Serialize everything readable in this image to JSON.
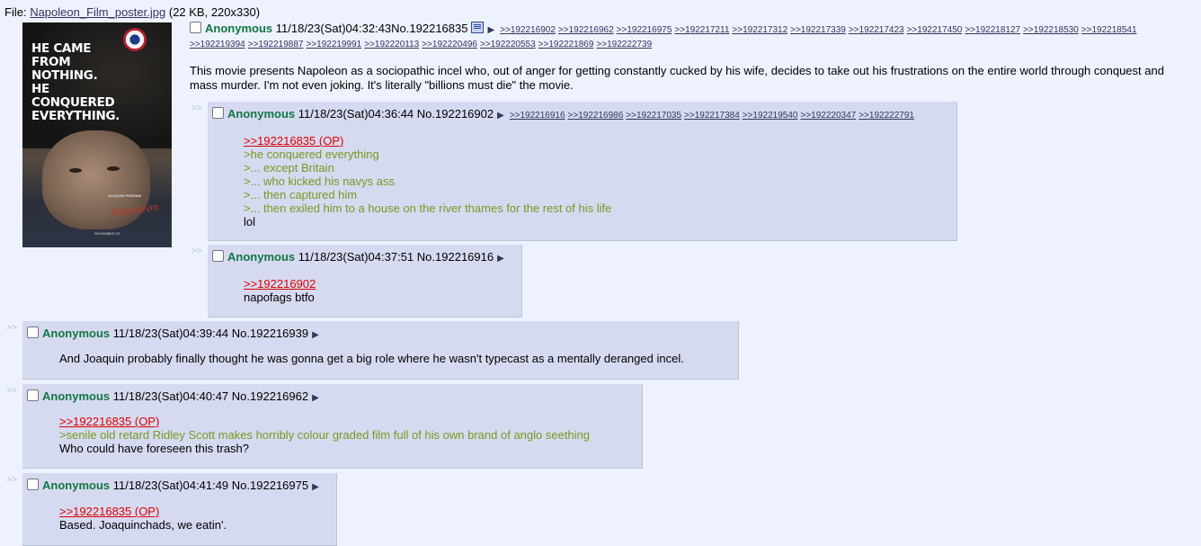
{
  "file": {
    "label": "File:",
    "name": "Napoleon_Film_poster.jpg",
    "info": "(22 KB, 220x330)",
    "poster_tagline": [
      "HE CAME FROM",
      "NOTHING.",
      "HE CONQUERED",
      "EVERYTHING."
    ],
    "poster_credits": "JOAQUIN PHOENIX",
    "poster_title": "Napoleon",
    "poster_release": "NOVEMBER 22"
  },
  "arrow": "▶",
  "side_arrows": ">>",
  "op": {
    "name": "Anonymous",
    "datetime": "11/18/23(Sat)04:32:43",
    "no_label": "No.",
    "no": "192216835",
    "backlinks_line1": [
      ">>192216902",
      ">>192216962",
      ">>192216975",
      ">>192217211",
      ">>192217312",
      ">>192217339",
      ">>192217423",
      ">>192217450",
      ">>192218127",
      ">>192218530",
      ">>192218541"
    ],
    "backlinks_line2": [
      ">>192219394",
      ">>192219887",
      ">>192219991",
      ">>192220113",
      ">>192220496",
      ">>192220553",
      ">>192221869",
      ">>192222739"
    ],
    "message": "This movie presents Napoleon as a sociopathic incel who, out of anger for getting constantly cucked by his wife, decides to take out his frustrations on the entire world through conquest and mass murder. I'm not even joking. It's literally \"billions must die\" the movie."
  },
  "replies": [
    {
      "name": "Anonymous",
      "datetime": "11/18/23(Sat)04:36:44",
      "no_label": "No.",
      "no": "192216902",
      "backlinks": [
        ">>192216916",
        ">>192216986",
        ">>192217035",
        ">>192217384",
        ">>192219540",
        ">>192220347",
        ">>192222791"
      ],
      "quotelink": ">>192216835 (OP)",
      "greentext": [
        ">he conquered everything",
        ">... except Britain",
        ">... who kicked his navys ass",
        ">... then captured him",
        ">... then exiled him to a house on the river thames for the rest of his life"
      ],
      "text": [
        "lol"
      ]
    },
    {
      "name": "Anonymous",
      "datetime": "11/18/23(Sat)04:37:51",
      "no_label": "No.",
      "no": "192216916",
      "quotelink": ">>192216902",
      "text": [
        "napofags btfo"
      ]
    },
    {
      "name": "Anonymous",
      "datetime": "11/18/23(Sat)04:39:44",
      "no_label": "No.",
      "no": "192216939",
      "text": [
        "And Joaquin probably finally thought he was gonna get a big role where he wasn't typecast as a mentally deranged incel."
      ]
    },
    {
      "name": "Anonymous",
      "datetime": "11/18/23(Sat)04:40:47",
      "no_label": "No.",
      "no": "192216962",
      "quotelink": ">>192216835 (OP)",
      "greentext": [
        ">senile old retard Ridley Scott makes horribly colour graded film full of his own brand of anglo seething"
      ],
      "text": [
        "Who could have foreseen this trash?"
      ]
    },
    {
      "name": "Anonymous",
      "datetime": "11/18/23(Sat)04:41:49",
      "no_label": "No.",
      "no": "192216975",
      "quotelink": ">>192216835 (OP)",
      "text": [
        "Based. Joaquinchads, we eatin'."
      ]
    }
  ],
  "colors": {
    "background": "#eef2ff",
    "reply_bg": "#d6daf0",
    "name": "#117743",
    "greentext": "#789922",
    "quotelink": "#dd0000"
  }
}
